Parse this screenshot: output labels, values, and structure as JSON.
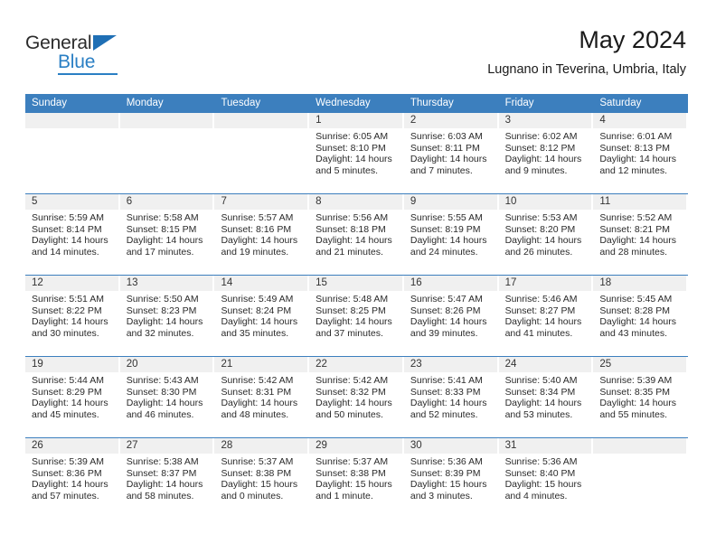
{
  "logo": {
    "word1": "General",
    "word2": "Blue",
    "icon": "triangle-logo-mark"
  },
  "header": {
    "title": "May 2024",
    "subtitle": "Lugnano in Teverina, Umbria, Italy"
  },
  "colors": {
    "header_blue": "#3c7fbe",
    "band_gray": "#f0f0f0",
    "logo_blue": "#2a7fc4",
    "text": "#2a2a2a"
  },
  "calendar": {
    "weekday_headers": [
      "Sunday",
      "Monday",
      "Tuesday",
      "Wednesday",
      "Thursday",
      "Friday",
      "Saturday"
    ],
    "weeks": [
      [
        {
          "day": "",
          "lines": []
        },
        {
          "day": "",
          "lines": []
        },
        {
          "day": "",
          "lines": []
        },
        {
          "day": "1",
          "lines": [
            "Sunrise: 6:05 AM",
            "Sunset: 8:10 PM",
            "Daylight: 14 hours",
            "and 5 minutes."
          ]
        },
        {
          "day": "2",
          "lines": [
            "Sunrise: 6:03 AM",
            "Sunset: 8:11 PM",
            "Daylight: 14 hours",
            "and 7 minutes."
          ]
        },
        {
          "day": "3",
          "lines": [
            "Sunrise: 6:02 AM",
            "Sunset: 8:12 PM",
            "Daylight: 14 hours",
            "and 9 minutes."
          ]
        },
        {
          "day": "4",
          "lines": [
            "Sunrise: 6:01 AM",
            "Sunset: 8:13 PM",
            "Daylight: 14 hours",
            "and 12 minutes."
          ]
        }
      ],
      [
        {
          "day": "5",
          "lines": [
            "Sunrise: 5:59 AM",
            "Sunset: 8:14 PM",
            "Daylight: 14 hours",
            "and 14 minutes."
          ]
        },
        {
          "day": "6",
          "lines": [
            "Sunrise: 5:58 AM",
            "Sunset: 8:15 PM",
            "Daylight: 14 hours",
            "and 17 minutes."
          ]
        },
        {
          "day": "7",
          "lines": [
            "Sunrise: 5:57 AM",
            "Sunset: 8:16 PM",
            "Daylight: 14 hours",
            "and 19 minutes."
          ]
        },
        {
          "day": "8",
          "lines": [
            "Sunrise: 5:56 AM",
            "Sunset: 8:18 PM",
            "Daylight: 14 hours",
            "and 21 minutes."
          ]
        },
        {
          "day": "9",
          "lines": [
            "Sunrise: 5:55 AM",
            "Sunset: 8:19 PM",
            "Daylight: 14 hours",
            "and 24 minutes."
          ]
        },
        {
          "day": "10",
          "lines": [
            "Sunrise: 5:53 AM",
            "Sunset: 8:20 PM",
            "Daylight: 14 hours",
            "and 26 minutes."
          ]
        },
        {
          "day": "11",
          "lines": [
            "Sunrise: 5:52 AM",
            "Sunset: 8:21 PM",
            "Daylight: 14 hours",
            "and 28 minutes."
          ]
        }
      ],
      [
        {
          "day": "12",
          "lines": [
            "Sunrise: 5:51 AM",
            "Sunset: 8:22 PM",
            "Daylight: 14 hours",
            "and 30 minutes."
          ]
        },
        {
          "day": "13",
          "lines": [
            "Sunrise: 5:50 AM",
            "Sunset: 8:23 PM",
            "Daylight: 14 hours",
            "and 32 minutes."
          ]
        },
        {
          "day": "14",
          "lines": [
            "Sunrise: 5:49 AM",
            "Sunset: 8:24 PM",
            "Daylight: 14 hours",
            "and 35 minutes."
          ]
        },
        {
          "day": "15",
          "lines": [
            "Sunrise: 5:48 AM",
            "Sunset: 8:25 PM",
            "Daylight: 14 hours",
            "and 37 minutes."
          ]
        },
        {
          "day": "16",
          "lines": [
            "Sunrise: 5:47 AM",
            "Sunset: 8:26 PM",
            "Daylight: 14 hours",
            "and 39 minutes."
          ]
        },
        {
          "day": "17",
          "lines": [
            "Sunrise: 5:46 AM",
            "Sunset: 8:27 PM",
            "Daylight: 14 hours",
            "and 41 minutes."
          ]
        },
        {
          "day": "18",
          "lines": [
            "Sunrise: 5:45 AM",
            "Sunset: 8:28 PM",
            "Daylight: 14 hours",
            "and 43 minutes."
          ]
        }
      ],
      [
        {
          "day": "19",
          "lines": [
            "Sunrise: 5:44 AM",
            "Sunset: 8:29 PM",
            "Daylight: 14 hours",
            "and 45 minutes."
          ]
        },
        {
          "day": "20",
          "lines": [
            "Sunrise: 5:43 AM",
            "Sunset: 8:30 PM",
            "Daylight: 14 hours",
            "and 46 minutes."
          ]
        },
        {
          "day": "21",
          "lines": [
            "Sunrise: 5:42 AM",
            "Sunset: 8:31 PM",
            "Daylight: 14 hours",
            "and 48 minutes."
          ]
        },
        {
          "day": "22",
          "lines": [
            "Sunrise: 5:42 AM",
            "Sunset: 8:32 PM",
            "Daylight: 14 hours",
            "and 50 minutes."
          ]
        },
        {
          "day": "23",
          "lines": [
            "Sunrise: 5:41 AM",
            "Sunset: 8:33 PM",
            "Daylight: 14 hours",
            "and 52 minutes."
          ]
        },
        {
          "day": "24",
          "lines": [
            "Sunrise: 5:40 AM",
            "Sunset: 8:34 PM",
            "Daylight: 14 hours",
            "and 53 minutes."
          ]
        },
        {
          "day": "25",
          "lines": [
            "Sunrise: 5:39 AM",
            "Sunset: 8:35 PM",
            "Daylight: 14 hours",
            "and 55 minutes."
          ]
        }
      ],
      [
        {
          "day": "26",
          "lines": [
            "Sunrise: 5:39 AM",
            "Sunset: 8:36 PM",
            "Daylight: 14 hours",
            "and 57 minutes."
          ]
        },
        {
          "day": "27",
          "lines": [
            "Sunrise: 5:38 AM",
            "Sunset: 8:37 PM",
            "Daylight: 14 hours",
            "and 58 minutes."
          ]
        },
        {
          "day": "28",
          "lines": [
            "Sunrise: 5:37 AM",
            "Sunset: 8:38 PM",
            "Daylight: 15 hours",
            "and 0 minutes."
          ]
        },
        {
          "day": "29",
          "lines": [
            "Sunrise: 5:37 AM",
            "Sunset: 8:38 PM",
            "Daylight: 15 hours",
            "and 1 minute."
          ]
        },
        {
          "day": "30",
          "lines": [
            "Sunrise: 5:36 AM",
            "Sunset: 8:39 PM",
            "Daylight: 15 hours",
            "and 3 minutes."
          ]
        },
        {
          "day": "31",
          "lines": [
            "Sunrise: 5:36 AM",
            "Sunset: 8:40 PM",
            "Daylight: 15 hours",
            "and 4 minutes."
          ]
        },
        {
          "day": "",
          "lines": []
        }
      ]
    ]
  }
}
